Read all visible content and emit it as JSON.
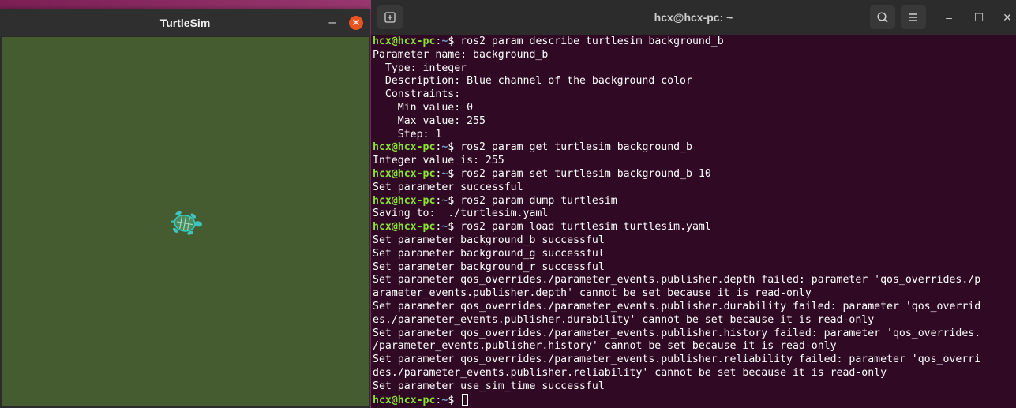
{
  "turtlesim": {
    "title": "TurtleSim",
    "minimize": "–",
    "close": "✕",
    "background_color": "#455b30"
  },
  "terminal": {
    "title": "hcx@hcx-pc: ~",
    "prompt_user": "hcx@hcx-pc",
    "prompt_sep": ":",
    "prompt_path": "~",
    "prompt_dollar": "$ ",
    "lines": [
      {
        "prompt": true,
        "text": "ros2 param describe turtlesim background_b"
      },
      {
        "prompt": false,
        "text": "Parameter name: background_b"
      },
      {
        "prompt": false,
        "text": "  Type: integer"
      },
      {
        "prompt": false,
        "text": "  Description: Blue channel of the background color"
      },
      {
        "prompt": false,
        "text": "  Constraints:"
      },
      {
        "prompt": false,
        "text": "    Min value: 0"
      },
      {
        "prompt": false,
        "text": "    Max value: 255"
      },
      {
        "prompt": false,
        "text": "    Step: 1"
      },
      {
        "prompt": true,
        "text": "ros2 param get turtlesim background_b"
      },
      {
        "prompt": false,
        "text": "Integer value is: 255"
      },
      {
        "prompt": true,
        "text": "ros2 param set turtlesim background_b 10"
      },
      {
        "prompt": false,
        "text": "Set parameter successful"
      },
      {
        "prompt": true,
        "text": "ros2 param dump turtlesim"
      },
      {
        "prompt": false,
        "text": "Saving to:  ./turtlesim.yaml"
      },
      {
        "prompt": true,
        "text": "ros2 param load turtlesim turtlesim.yaml"
      },
      {
        "prompt": false,
        "text": "Set parameter background_b successful"
      },
      {
        "prompt": false,
        "text": "Set parameter background_g successful"
      },
      {
        "prompt": false,
        "text": "Set parameter background_r successful"
      },
      {
        "prompt": false,
        "text": "Set parameter qos_overrides./parameter_events.publisher.depth failed: parameter 'qos_overrides./p"
      },
      {
        "prompt": false,
        "text": "arameter_events.publisher.depth' cannot be set because it is read-only"
      },
      {
        "prompt": false,
        "text": "Set parameter qos_overrides./parameter_events.publisher.durability failed: parameter 'qos_overrid"
      },
      {
        "prompt": false,
        "text": "es./parameter_events.publisher.durability' cannot be set because it is read-only"
      },
      {
        "prompt": false,
        "text": "Set parameter qos_overrides./parameter_events.publisher.history failed: parameter 'qos_overrides."
      },
      {
        "prompt": false,
        "text": "/parameter_events.publisher.history' cannot be set because it is read-only"
      },
      {
        "prompt": false,
        "text": "Set parameter qos_overrides./parameter_events.publisher.reliability failed: parameter 'qos_overri"
      },
      {
        "prompt": false,
        "text": "des./parameter_events.publisher.reliability' cannot be set because it is read-only"
      },
      {
        "prompt": false,
        "text": "Set parameter use_sim_time successful"
      },
      {
        "prompt": true,
        "text": "",
        "cursor": true
      }
    ],
    "colors": {
      "background": "#300a24",
      "prompt_user": "#8ae234",
      "prompt_path": "#729fcf",
      "text": "#ffffff"
    }
  }
}
